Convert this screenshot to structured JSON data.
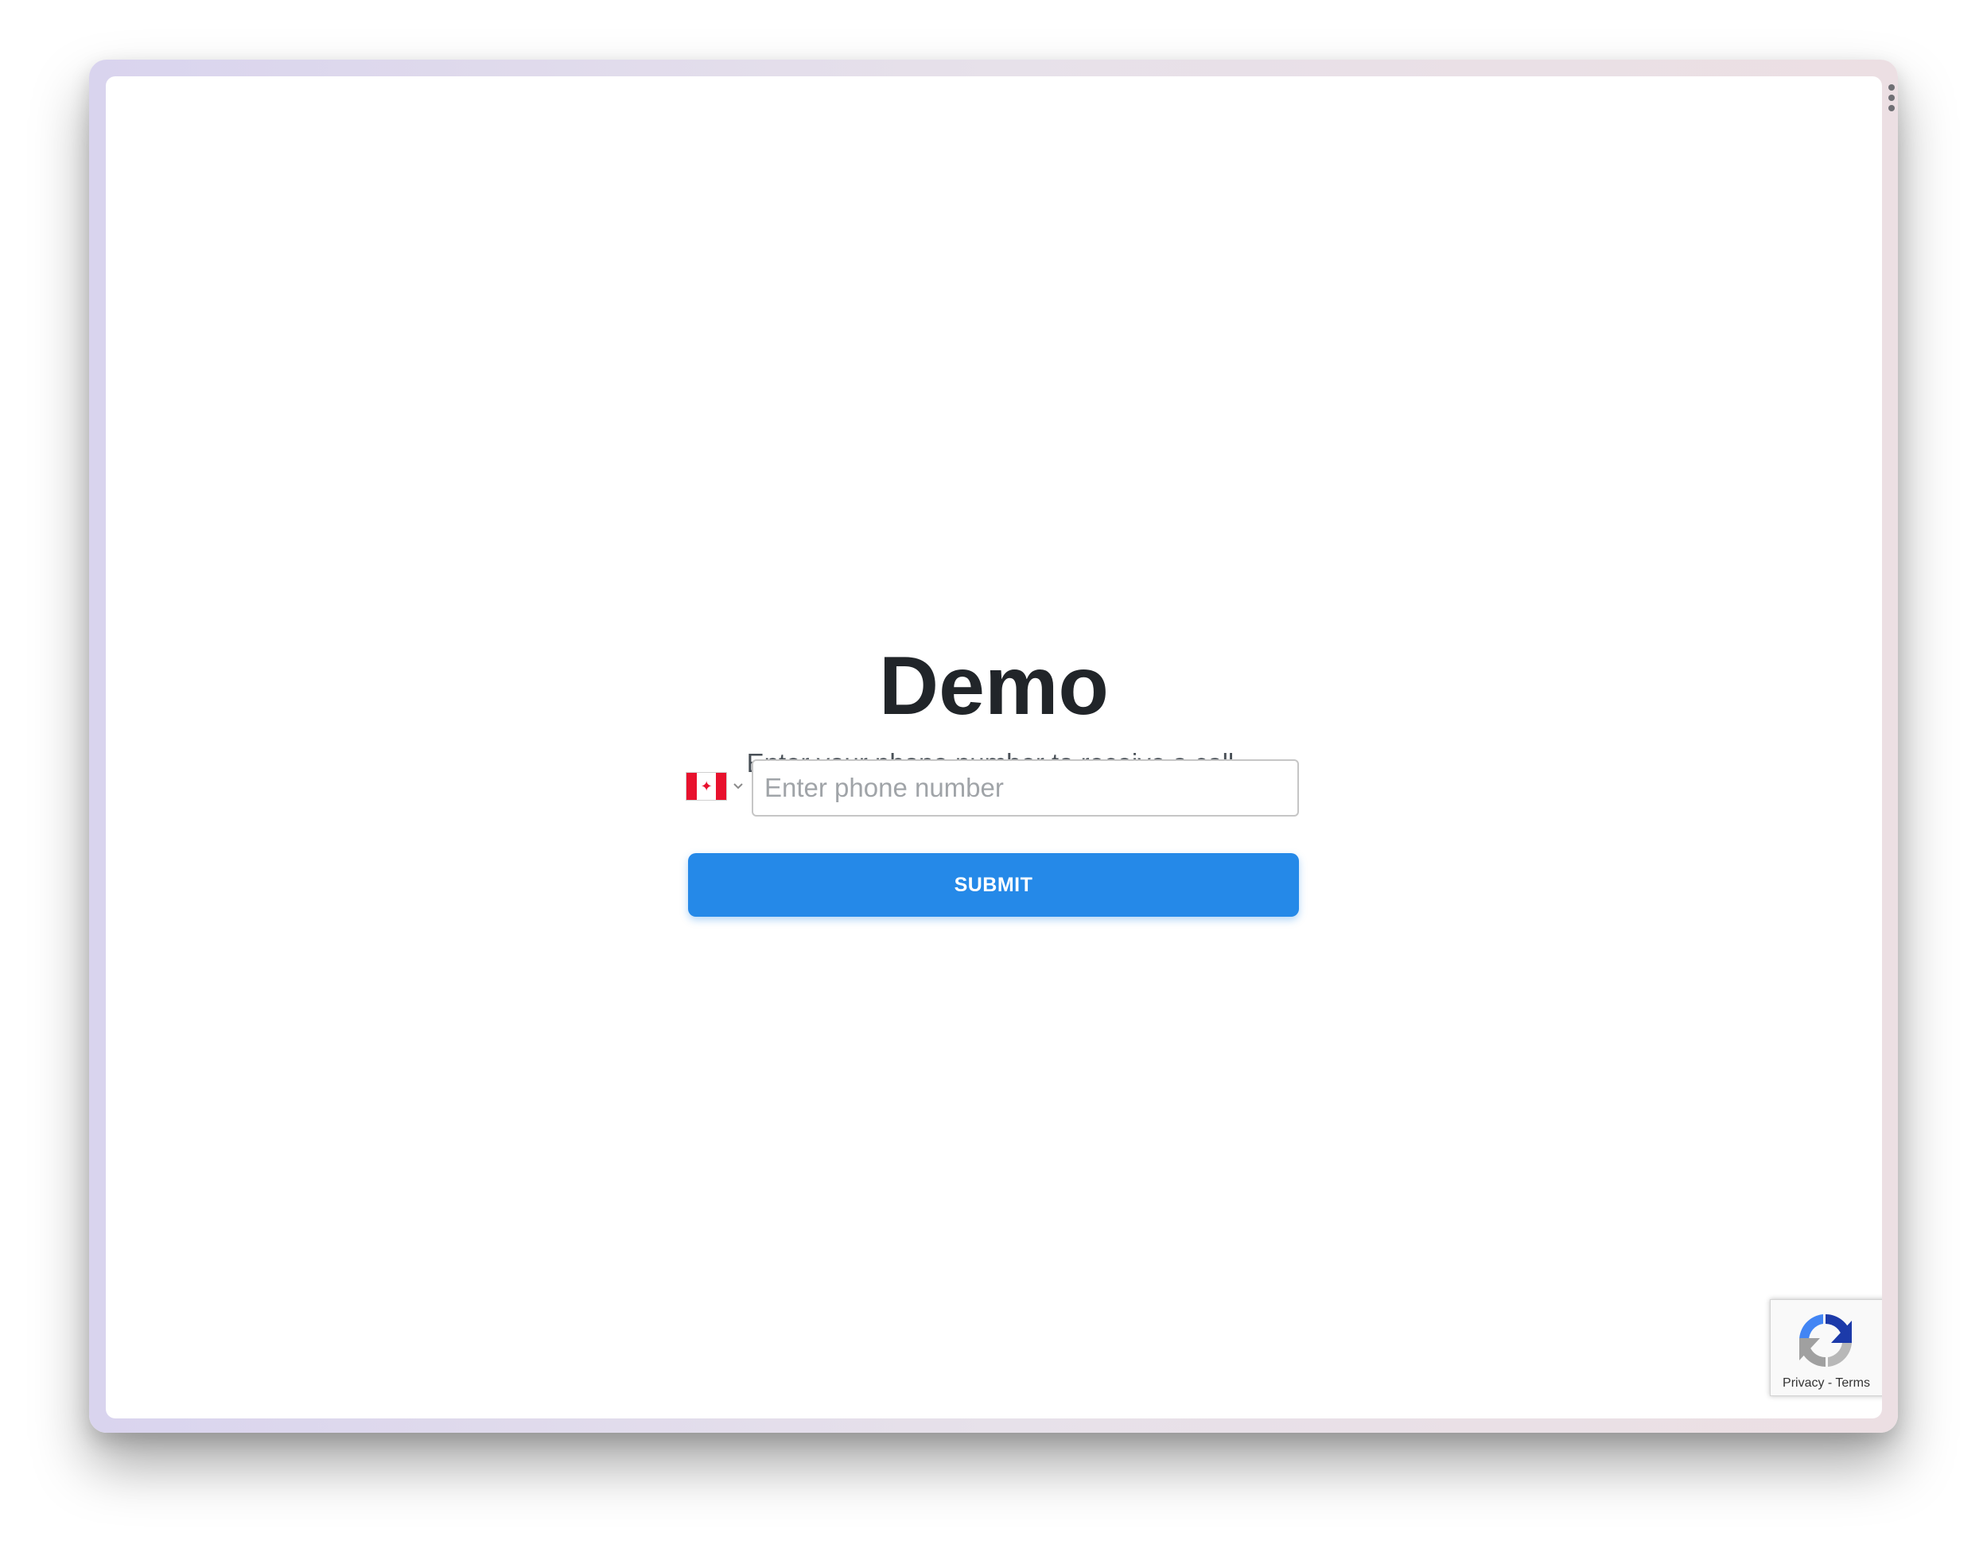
{
  "page": {
    "title": "Demo",
    "subtitle": "Enter your phone number to receive a call."
  },
  "form": {
    "country": "Canada",
    "country_flag_icon": "canada-flag-icon",
    "phone_value": "",
    "phone_placeholder": "Enter phone number",
    "submit_label": "SUBMIT"
  },
  "recaptcha": {
    "privacy_label": "Privacy",
    "separator": " - ",
    "terms_label": "Terms"
  },
  "colors": {
    "accent": "#2589e8",
    "title": "#212529",
    "subtitle": "#495057",
    "flag_red": "#e8112d"
  }
}
